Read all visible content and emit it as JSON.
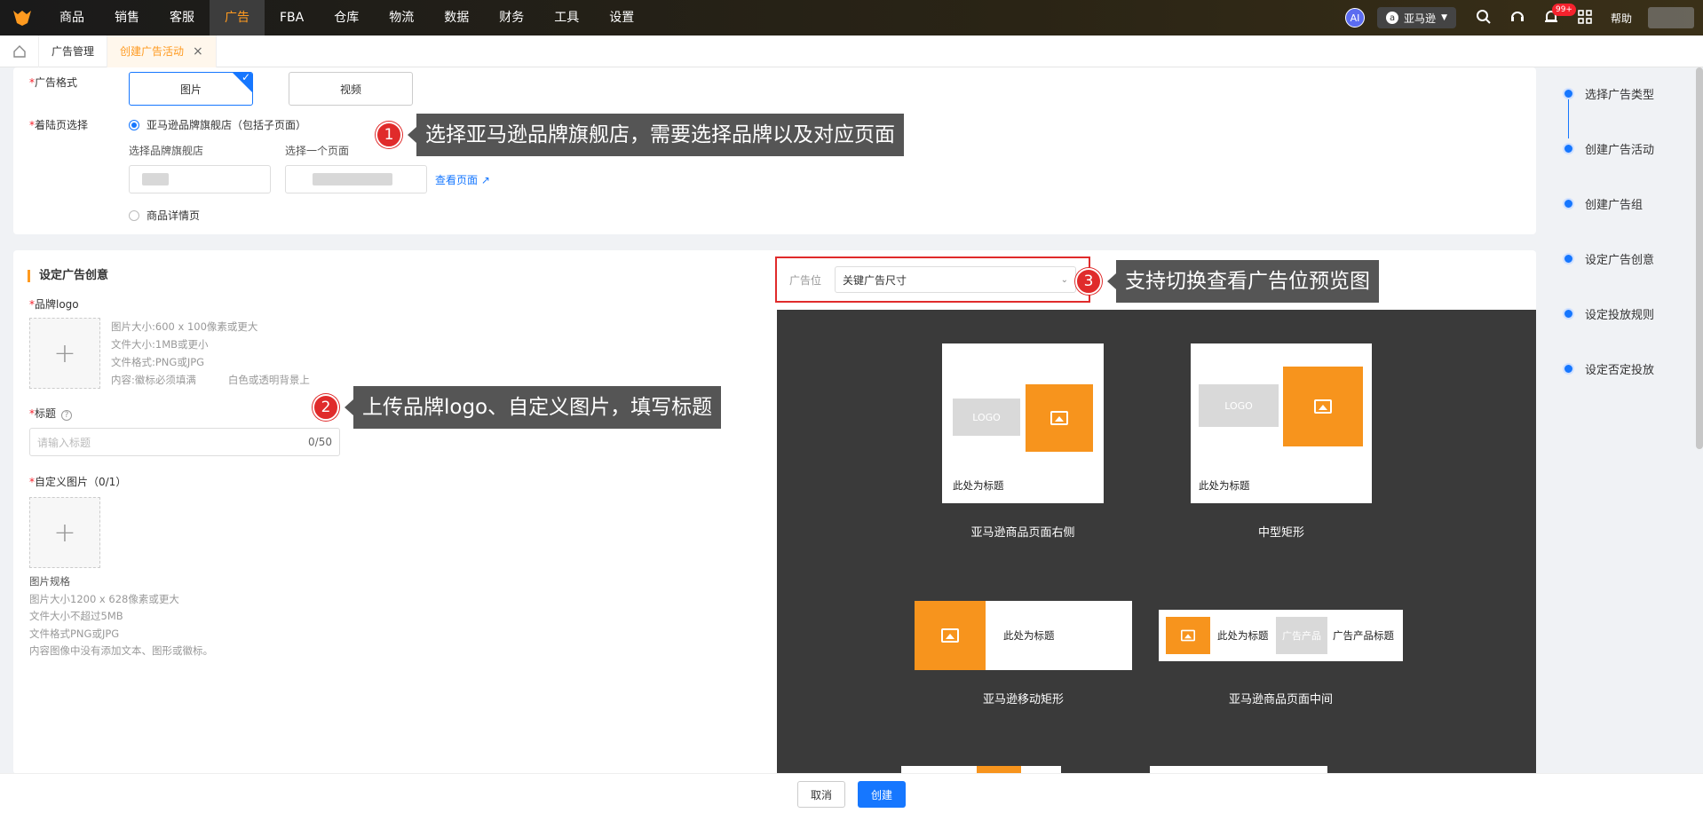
{
  "topbar": {
    "nav": [
      "商品",
      "销售",
      "客服",
      "广告",
      "FBA",
      "仓库",
      "物流",
      "数据",
      "财务",
      "工具",
      "设置"
    ],
    "active_nav": "广告",
    "ai_label": "AI",
    "store": "亚马逊",
    "notification_count": "99+",
    "help": "帮助"
  },
  "tabs": {
    "items": [
      "广告管理",
      "创建广告活动"
    ]
  },
  "format": {
    "label": "广告格式",
    "options": [
      "图片",
      "视频"
    ]
  },
  "landing": {
    "label": "着陆页选择",
    "option_store": "亚马逊品牌旗舰店（包括子页面）",
    "brand_store_label": "选择品牌旗舰店",
    "page_label": "选择一个页面",
    "view_page": "查看页面",
    "option_detail": "商品详情页"
  },
  "callouts": {
    "c1_num": "1",
    "c1_text": "选择亚马逊品牌旗舰店，需要选择品牌以及对应页面",
    "c2_num": "2",
    "c2_text": "上传品牌logo、自定义图片，填写标题",
    "c3_num": "3",
    "c3_text": "支持切换查看广告位预览图"
  },
  "creative": {
    "section_title": "设定广告创意",
    "logo_label": "品牌logo",
    "logo_hints": [
      "图片大小:600 x 100像素或更大",
      "文件大小:1MB或更小",
      "文件格式:PNG或JPG",
      "内容:徽标必须填满",
      "白色或透明背景上"
    ],
    "title_label": "标题",
    "title_placeholder": "请输入标题",
    "title_count": "0/50",
    "custom_image_label": "自定义图片（0/1）",
    "spec_title": "图片规格",
    "spec_lines": [
      "图片大小1200 x 628像素或更大",
      "文件大小不超过5MB",
      "文件格式PNG或JPG",
      "内容图像中没有添加文本、图形或徽标。"
    ]
  },
  "placement": {
    "label": "广告位",
    "selected": "关键广告尺寸"
  },
  "preview": {
    "logo_text": "LOGO",
    "headline": "此处为标题",
    "product_text": "广告产品",
    "product_title": "广告产品标题",
    "captions": [
      "亚马逊商品页面右侧",
      "中型矩形",
      "亚马逊移动矩形",
      "亚马逊商品页面中间"
    ]
  },
  "steps": [
    "选择广告类型",
    "创建广告活动",
    "创建广告组",
    "设定广告创意",
    "设定投放规则",
    "设定否定投放"
  ],
  "footer": {
    "cancel": "取消",
    "create": "创建"
  },
  "colors": {
    "accent": "#ff9a1f",
    "primary": "#1677ff",
    "callout_red": "#e02b2b",
    "preview_bg": "#3a3a3a",
    "preview_orange": "#f7941d"
  }
}
